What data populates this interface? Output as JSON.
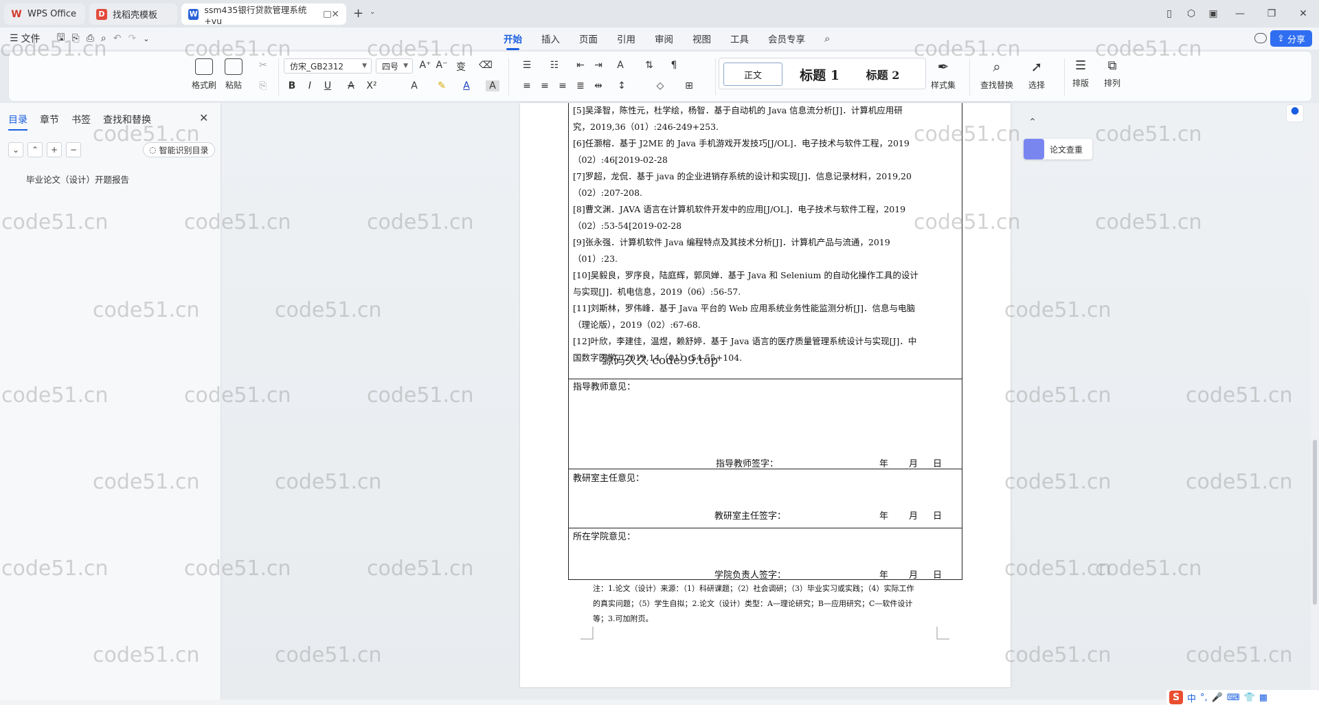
{
  "tabs": [
    {
      "label": "WPS Office",
      "icon_color": "#d33a31",
      "icon_text": "W"
    },
    {
      "label": "找稻壳模板",
      "icon_color": "#e24a3b",
      "icon_text": "D"
    },
    {
      "label": "ssm435银行贷款管理系统+vu",
      "icon_color": "#2b62d9",
      "icon_text": "W"
    }
  ],
  "menu": {
    "file": "文件",
    "tabs": [
      "开始",
      "插入",
      "页面",
      "引用",
      "审阅",
      "视图",
      "工具",
      "会员专享"
    ],
    "share": "分享"
  },
  "ribbon": {
    "format_painter": "格式刷",
    "paste": "粘贴",
    "font_name": "仿宋_GB2312",
    "font_size": "四号",
    "style_normal": "正文",
    "style_h1": "标题 1",
    "style_h2": "标题 2",
    "style_set": "样式集",
    "find_replace": "查找替换",
    "select": "选择",
    "layout": "排版",
    "arrange": "排列"
  },
  "nav": {
    "tabs": [
      "目录",
      "章节",
      "书签",
      "查找和替换"
    ],
    "smart_toc": "智能识别目录",
    "toc_items": [
      "毕业论文（设计）开题报告"
    ]
  },
  "references": [
    "[5]吴泽智，陈性元，杜学绘，杨智．基于自动机的 Java 信息流分析[J]．计算机应用研",
    "究，2019,36（01）:246-249+253.",
    "[6]任灏榕．基于 J2ME 的 Java 手机游戏开发技巧[J/OL]．电子技术与软件工程，2019",
    "（02）:46[2019-02-28",
    "[7]罗超，龙侃．基于 java 的企业进销存系统的设计和实现[J]．信息记录材料，2019,20",
    "（02）:207-208.",
    "[8]曹文渊．JAVA 语言在计算机软件开发中的应用[J/OL]．电子技术与软件工程，2019",
    "（02）:53-54[2019-02-28",
    "[9]张永强．计算机软件 Java 编程特点及其技术分析[J]．计算机产品与流通，2019",
    "（01）:23.",
    "[10]吴毅良，罗序良，陆庭辉，郭凤婵．基于 Java 和 Selenium 的自动化操作工具的设计",
    "与实现[J]．机电信息，2019（06）:56-57.",
    "[11]刘斯林，罗伟峰．基于 Java 平台的 Web 应用系统业务性能监测分析[J]．信息与电脑",
    "（理论版），2019（02）:67-68.",
    "[12]叶欣，李建佳，温煜，赖舒婷．基于 Java 语言的医疗质量管理系统设计与实现[J]．中",
    "国数字医学，2019,14（01）:54-55+104."
  ],
  "form": {
    "advisor_opinion": "指导教师意见：",
    "advisor_sign": "指导教师签字：",
    "office_opinion": "教研室主任意见：",
    "office_sign": "教研室主任签字：",
    "college_opinion": "所在学院意见：",
    "college_sign": "学院负责人签字：",
    "year": "年",
    "month": "月",
    "day": "日"
  },
  "notes": [
    "注：1.论文（设计）来源：（1）科研课题；（2）社会调研；（3）毕业实习或实践；（4）实际工作",
    "的真实问题；（5）学生自拟；2.论文（设计）类型：A—理论研究；B—应用研究；C—软件设计",
    "等；3.可加附页。"
  ],
  "overlay_text": "源码久久 code99.top",
  "watermark": "code51.cn",
  "side": {
    "plagiarism_check": "论文查重"
  },
  "ime": {
    "lang": "中"
  }
}
